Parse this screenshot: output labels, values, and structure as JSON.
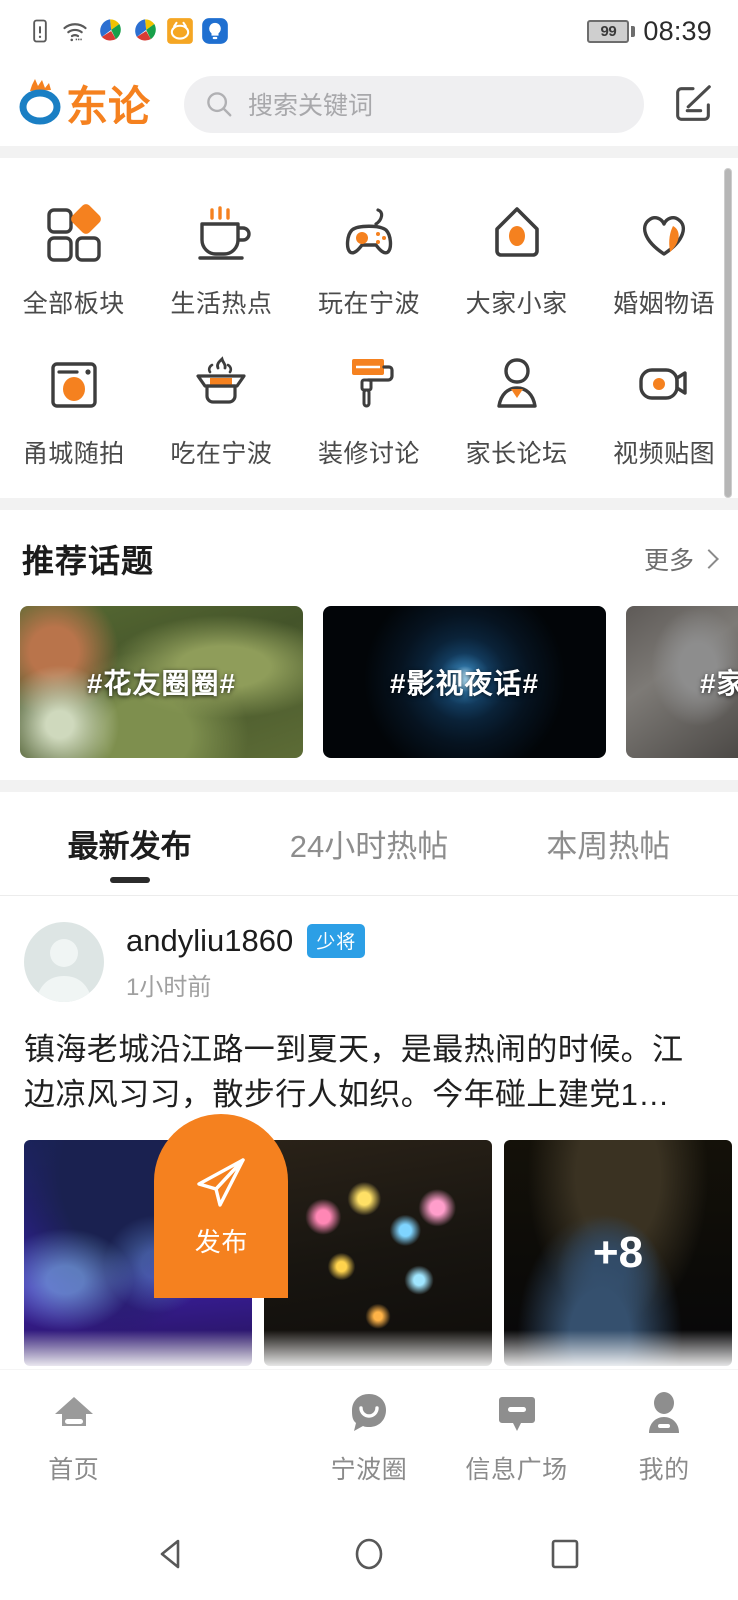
{
  "statusbar": {
    "battery_level": "99",
    "time": "08:39",
    "icons": [
      "sim-alert-icon",
      "wifi-icon",
      "app-badge-icon-1",
      "app-badge-icon-2",
      "alarm-icon",
      "flashlight-icon"
    ]
  },
  "header": {
    "logo_text": "东论",
    "search_placeholder": "搜索关键词",
    "search_icon": "search-icon",
    "compose_icon": "compose-icon"
  },
  "grid": {
    "rows": [
      [
        {
          "label": "全部板块",
          "icon": "blocks-icon"
        },
        {
          "label": "生活热点",
          "icon": "coffee-cup-icon"
        },
        {
          "label": "玩在宁波",
          "icon": "gamepad-icon"
        },
        {
          "label": "大家小家",
          "icon": "house-icon"
        },
        {
          "label": "婚姻物语",
          "icon": "heart-icon"
        }
      ],
      [
        {
          "label": "甬城随拍",
          "icon": "camera-icon"
        },
        {
          "label": "吃在宁波",
          "icon": "hotpot-icon"
        },
        {
          "label": "装修讨论",
          "icon": "paint-roller-icon"
        },
        {
          "label": "家长论坛",
          "icon": "person-icon"
        },
        {
          "label": "视频贴图",
          "icon": "video-icon"
        }
      ]
    ]
  },
  "topics": {
    "title": "推荐话题",
    "more_label": "更多",
    "cards": [
      {
        "label": "#花友圈圈#",
        "bg": "garden-photo"
      },
      {
        "label": "#影视夜话#",
        "bg": "camera-lens-photo"
      },
      {
        "label": "#家",
        "bg": "cat-photo"
      }
    ]
  },
  "feed_tabs": [
    {
      "label": "最新发布",
      "active": true
    },
    {
      "label": "24小时热帖",
      "active": false
    },
    {
      "label": "本周热帖",
      "active": false
    }
  ],
  "post": {
    "author": "andyliu1860",
    "rank_badge": "少将",
    "time": "1小时前",
    "text": "镇海老城沿江路一到夏天，是最热闹的时候。江边凉风习习，散步行人如织。今年碰上建党1…",
    "images": [
      {
        "alt": "neon-wave-wall-night-photo",
        "overlay": ""
      },
      {
        "alt": "lit-paper-cranes-tree-photo",
        "overlay": ""
      },
      {
        "alt": "illuminated-path-photo",
        "overlay": "+8"
      }
    ]
  },
  "bottom_nav": [
    {
      "label": "首页",
      "icon": "home-icon",
      "active": false
    },
    {
      "label": "发布",
      "icon": "send-paper-plane-icon",
      "active": true
    },
    {
      "label": "宁波圈",
      "icon": "chat-bubble-icon",
      "active": false
    },
    {
      "label": "信息广场",
      "icon": "message-board-icon",
      "active": false
    },
    {
      "label": "我的",
      "icon": "user-profile-icon",
      "active": false
    }
  ],
  "android_nav": [
    {
      "name": "back-button",
      "icon": "triangle-back-icon"
    },
    {
      "name": "home-button",
      "icon": "circle-home-icon"
    },
    {
      "name": "recents-button",
      "icon": "square-recents-icon"
    }
  ],
  "colors": {
    "accent_orange": "#f5811f",
    "logo_blue": "#1a7fc4",
    "badge_blue": "#2c9fe6"
  }
}
